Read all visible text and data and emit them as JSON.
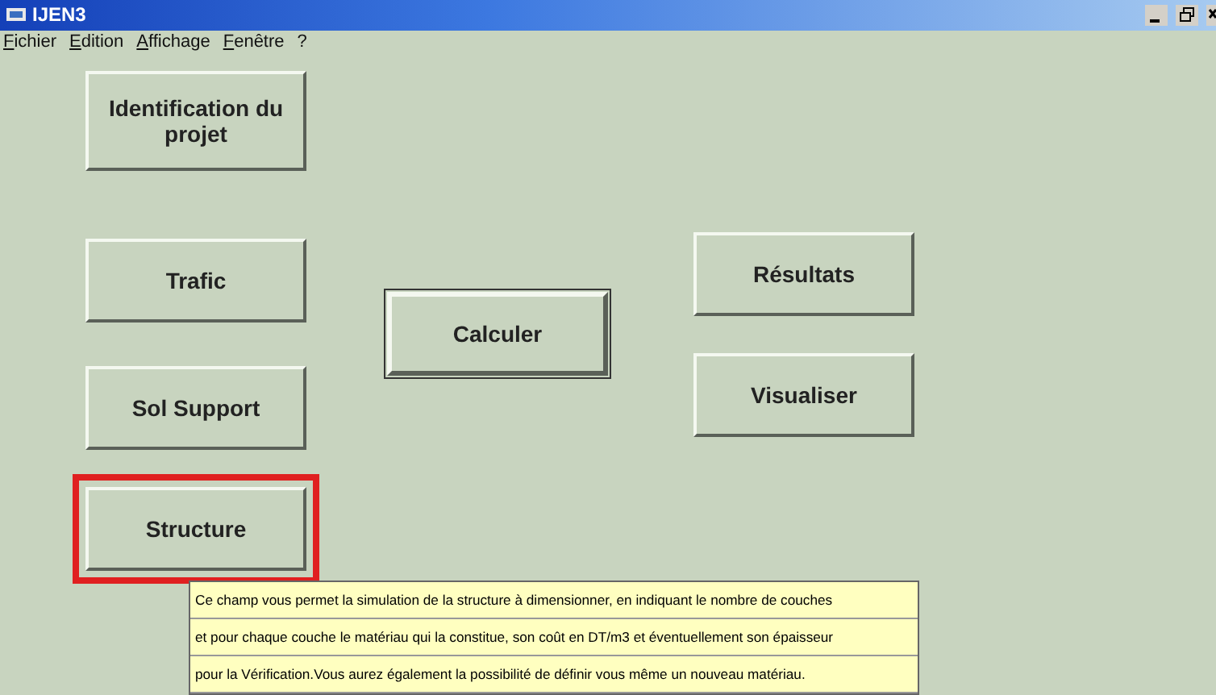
{
  "window": {
    "title": "IJEN3"
  },
  "menu": [
    {
      "label": "Fichier"
    },
    {
      "label": "Edition"
    },
    {
      "label": "Affichage"
    },
    {
      "label": "Fenêtre"
    },
    {
      "label": "?"
    }
  ],
  "columns": [
    {
      "buttons": [
        {
          "label": "Identification du projet",
          "selected": false,
          "default": false
        },
        {
          "label": "Trafic",
          "selected": false,
          "default": false
        },
        {
          "label": "Sol Support",
          "selected": false,
          "default": false
        },
        {
          "label": "Structure",
          "selected": true,
          "default": false
        }
      ]
    },
    {
      "buttons": [
        {
          "label": "Calculer",
          "selected": false,
          "default": true
        }
      ]
    },
    {
      "buttons": [
        {
          "label": "Résultats",
          "selected": false,
          "default": false
        },
        {
          "label": "Visualiser",
          "selected": false,
          "default": false
        }
      ]
    }
  ],
  "help_lines": [
    "Ce champ vous permet la simulation de la structure à dimensionner, en indiquant le nombre de couches",
    "et pour chaque couche le matériau qui la constitue, son coût en DT/m3 et éventuellement son épaisseur",
    "pour la Vérification.Vous aurez également la possibilité de définir vous même un nouveau matériau."
  ]
}
